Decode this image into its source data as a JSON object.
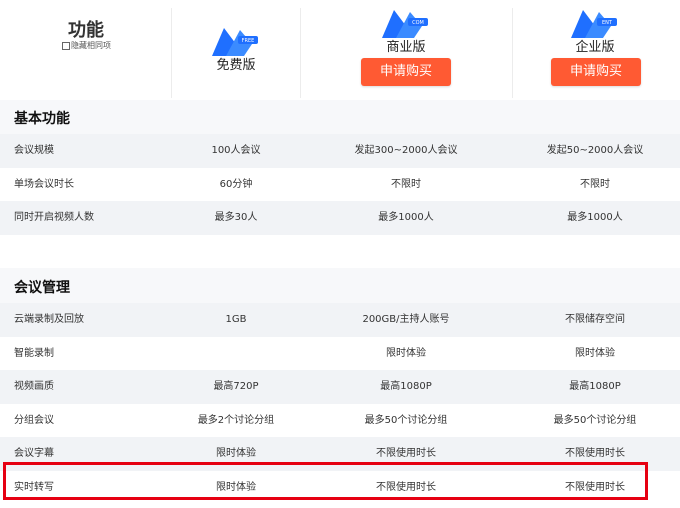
{
  "header": {
    "feature_title": "功能",
    "hide_same_label": "隐藏相同项",
    "plans": [
      {
        "name": "免费版",
        "logo_badge": "FREE",
        "has_buy": false
      },
      {
        "name": "商业版",
        "logo_badge": "COM",
        "has_buy": true,
        "buy_label": "申请购买"
      },
      {
        "name": "企业版",
        "logo_badge": "ENT",
        "has_buy": true,
        "buy_label": "申请购买"
      }
    ]
  },
  "colors": {
    "accent": "#ff5a33",
    "logo_blue": "#1f6fff",
    "highlight": "#e60012"
  },
  "sections": [
    {
      "title": "基本功能",
      "rows": [
        {
          "feature": "会议规模",
          "free": "100人会议",
          "business": "发起300~2000人会议",
          "enterprise": "发起50~2000人会议"
        },
        {
          "feature": "单场会议时长",
          "free": "60分钟",
          "business": "不限时",
          "enterprise": "不限时"
        },
        {
          "feature": "同时开启视频人数",
          "free": "最多30人",
          "business": "最多1000人",
          "enterprise": "最多1000人"
        }
      ]
    },
    {
      "title": "会议管理",
      "rows": [
        {
          "feature": "云端录制及回放",
          "free": "1GB",
          "business": "200GB/主持人账号",
          "enterprise": "不限储存空间"
        },
        {
          "feature": "智能录制",
          "free": "",
          "business": "限时体验",
          "enterprise": "限时体验"
        },
        {
          "feature": "视频画质",
          "free": "最高720P",
          "business": "最高1080P",
          "enterprise": "最高1080P"
        },
        {
          "feature": "分组会议",
          "free": "最多2个讨论分组",
          "business": "最多50个讨论分组",
          "enterprise": "最多50个讨论分组"
        },
        {
          "feature": "会议字幕",
          "free": "限时体验",
          "business": "不限使用时长",
          "enterprise": "不限使用时长"
        },
        {
          "feature": "实时转写",
          "free": "限时体验",
          "business": "不限使用时长",
          "enterprise": "不限使用时长"
        }
      ]
    }
  ]
}
